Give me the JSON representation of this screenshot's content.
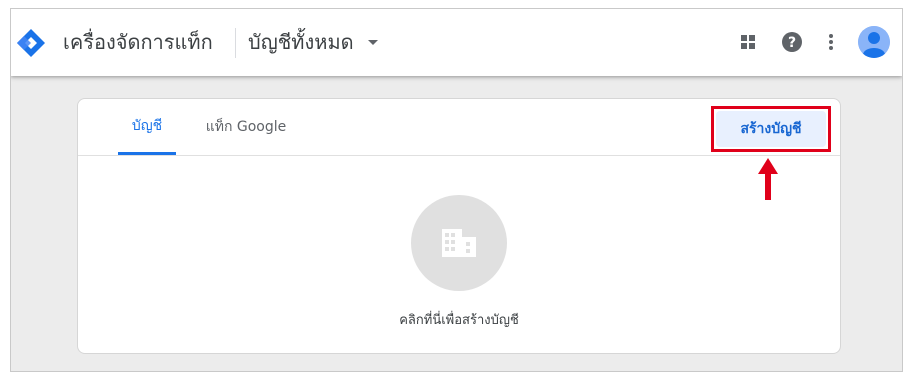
{
  "header": {
    "app_title": "เครื่องจัดการแท็ก",
    "account_selector": "บัญชีทั้งหมด",
    "icons": [
      "apps-grid-icon",
      "help-icon",
      "more-vert-icon",
      "account-avatar-icon"
    ]
  },
  "card": {
    "tabs": [
      {
        "label": "บัญชี",
        "active": true
      },
      {
        "label": "แท็ก Google",
        "active": false
      }
    ],
    "create_account_label": "สร้างบัญชี",
    "empty_state_icon": "building-icon",
    "empty_state_text": "คลิกที่นี่เพื่อสร้างบัญชี"
  },
  "colors": {
    "accent": "#1a73e8",
    "annotation_red": "#e0001a",
    "logo_blue": "#1a73e8"
  }
}
